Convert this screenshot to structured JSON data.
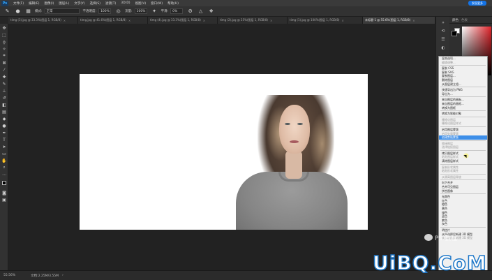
{
  "menubar": {
    "logo": "Ps",
    "items": [
      "文件(F)",
      "编辑(E)",
      "图像(I)",
      "图层(L)",
      "文字(Y)",
      "选择(S)",
      "滤镜(T)",
      "3D(D)",
      "视图(V)",
      "窗口(W)",
      "帮助(H)"
    ],
    "top_right_button": "发现更多"
  },
  "options": {
    "mode_label": "模式:",
    "mode_value": "正常",
    "opacity_label": "不透明度:",
    "opacity_value": "100%",
    "flow_label": "流量:",
    "flow_value": "100%",
    "smooth_label": "平滑:",
    "smooth_value": "0%"
  },
  "tabs": [
    {
      "label": "timg (3).jpg @ 33.3%(图层 1, RGB/8)"
    },
    {
      "label": "timg.jpg @ 41.6%(图层 1, RGB/8)"
    },
    {
      "label": "timg (4).jpg @ 33.3%(图层 1, RGB/8)"
    },
    {
      "label": "timg (2).jpg @ 25%(图层 1, RGB/8)"
    },
    {
      "label": "timg (1).jpg @ 100%(图层 1, RGB/8)"
    },
    {
      "label": "未标题-1 @ 55.6%(图层 1, RGB/8)"
    }
  ],
  "status": {
    "zoom": "55.56%",
    "doc_info": "文档:2.25M/3.55M"
  },
  "right_panel": {
    "tab_color": "颜色",
    "tab_swatch": "色板"
  },
  "context_menu": {
    "items": [
      {
        "label": "混合选项...",
        "state": "normal"
      },
      {
        "label": "编辑调整...",
        "state": "disabled"
      },
      {
        "sep": true
      },
      {
        "label": "复制 CSS",
        "state": "normal"
      },
      {
        "label": "复制 SVG",
        "state": "normal"
      },
      {
        "label": "复制图层...",
        "state": "normal"
      },
      {
        "label": "删除图层",
        "state": "normal"
      },
      {
        "label": "从图层建立组...",
        "state": "normal"
      },
      {
        "sep": true
      },
      {
        "label": "快速导出为 PNG",
        "state": "normal"
      },
      {
        "label": "导出为...",
        "state": "normal"
      },
      {
        "sep": true
      },
      {
        "label": "来自图层的画板...",
        "state": "normal"
      },
      {
        "label": "来自图层的画框...",
        "state": "normal"
      },
      {
        "label": "转换为图框",
        "state": "normal"
      },
      {
        "sep": true
      },
      {
        "label": "转换为智能对象",
        "state": "normal"
      },
      {
        "sep": true
      },
      {
        "label": "栅格化图层",
        "state": "disabled"
      },
      {
        "label": "栅格化图层样式",
        "state": "disabled"
      },
      {
        "sep": true
      },
      {
        "label": "启用图层蒙版",
        "state": "normal"
      },
      {
        "label": "启用矢量蒙版",
        "state": "disabled"
      },
      {
        "label": "创建剪贴蒙版",
        "state": "highlighted"
      },
      {
        "sep": true
      },
      {
        "label": "链接图层",
        "state": "disabled"
      },
      {
        "label": "选择链接图层",
        "state": "disabled"
      },
      {
        "sep": true
      },
      {
        "label": "拷贝图层样式",
        "state": "normal"
      },
      {
        "label": "粘贴图层样式",
        "state": "disabled"
      },
      {
        "label": "清除图层样式",
        "state": "normal"
      },
      {
        "sep": true
      },
      {
        "label": "复制形状属性",
        "state": "disabled"
      },
      {
        "label": "粘贴形状属性",
        "state": "disabled"
      },
      {
        "sep": true
      },
      {
        "label": "从隔离图层释放",
        "state": "disabled"
      },
      {
        "sep": true
      },
      {
        "label": "向下合并",
        "state": "normal"
      },
      {
        "label": "合并可见图层",
        "state": "normal"
      },
      {
        "label": "拼合图像",
        "state": "normal"
      },
      {
        "sep": true
      },
      {
        "label": "无颜色",
        "state": "normal"
      },
      {
        "label": "红色",
        "state": "normal"
      },
      {
        "label": "橙色",
        "state": "normal"
      },
      {
        "label": "黄色",
        "state": "normal"
      },
      {
        "label": "绿色",
        "state": "normal"
      },
      {
        "label": "蓝色",
        "state": "normal"
      },
      {
        "label": "紫色",
        "state": "normal"
      },
      {
        "label": "灰色",
        "state": "normal"
      },
      {
        "sep": true
      },
      {
        "label": "明信片",
        "state": "normal"
      },
      {
        "label": "从所选图层新建 3D 模型",
        "state": "normal"
      },
      {
        "label": "从当前选区新建 3D 模型",
        "state": "disabled"
      }
    ]
  },
  "watermark": {
    "sub": "PS 教程",
    "main": "UiBQ.CoM"
  },
  "colors": {
    "accent": "#1473e6",
    "highlight": "#3d8ee8"
  }
}
